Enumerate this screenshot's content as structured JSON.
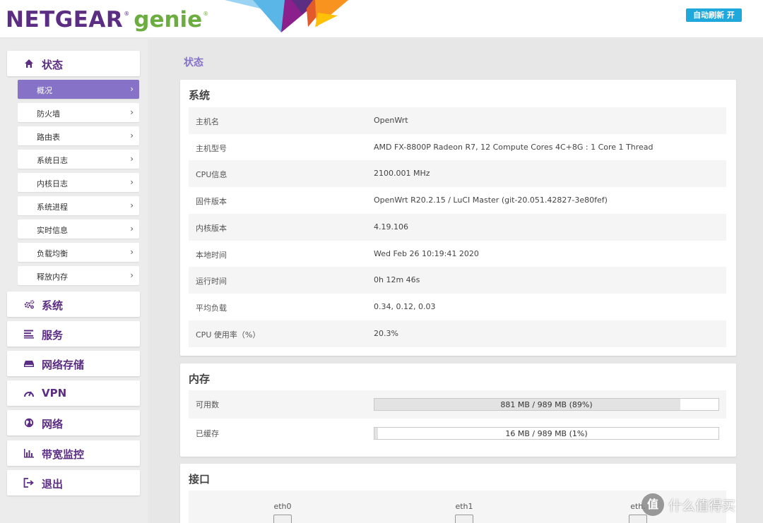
{
  "header": {
    "logo_main": "NETGEAR",
    "logo_reg": "®",
    "logo_genie": "genie",
    "logo_reg2": "®",
    "auto_refresh_label": "自动刷新 开",
    "colors": {
      "brand_purple": "#5b2d83",
      "brand_green": "#6cad3f",
      "refresh_blue": "#1ea8dc"
    }
  },
  "sidebar": {
    "status": {
      "label": "状态",
      "icon": "home-icon"
    },
    "status_items": [
      {
        "label": "概况",
        "active": true
      },
      {
        "label": "防火墙"
      },
      {
        "label": "路由表"
      },
      {
        "label": "系统日志"
      },
      {
        "label": "内核日志"
      },
      {
        "label": "系统进程"
      },
      {
        "label": "实时信息"
      },
      {
        "label": "负载均衡"
      },
      {
        "label": "释放内存"
      }
    ],
    "chevron": "›",
    "main_items": [
      {
        "label": "系统",
        "icon": "gears-icon"
      },
      {
        "label": "服务",
        "icon": "list-icon"
      },
      {
        "label": "网络存储",
        "icon": "storage-icon"
      },
      {
        "label": "VPN",
        "icon": "gauge-icon"
      },
      {
        "label": "网络",
        "icon": "globe-icon"
      },
      {
        "label": "带宽监控",
        "icon": "bar-chart-icon"
      },
      {
        "label": "退出",
        "icon": "logout-icon"
      }
    ],
    "active_color": "#8672c6"
  },
  "main": {
    "page_title": "状态",
    "system": {
      "title": "系统",
      "rows": [
        {
          "key": "主机名",
          "value": "OpenWrt"
        },
        {
          "key": "主机型号",
          "value": "AMD FX-8800P Radeon R7, 12 Compute Cores 4C+8G : 1 Core 1 Thread"
        },
        {
          "key": "CPU信息",
          "value": "2100.001 MHz"
        },
        {
          "key": "固件版本",
          "value": "OpenWrt R20.2.15 / LuCI Master (git-20.051.42827-3e80fef)"
        },
        {
          "key": "内核版本",
          "value": "4.19.106"
        },
        {
          "key": "本地时间",
          "value": "Wed Feb 26 10:19:41 2020"
        },
        {
          "key": "运行时间",
          "value": "0h 12m 46s"
        },
        {
          "key": "平均负载",
          "value": "0.34, 0.12, 0.03"
        },
        {
          "key": "CPU 使用率（%）",
          "value": "20.3%"
        }
      ]
    },
    "memory": {
      "title": "内存",
      "rows": [
        {
          "key": "可用数",
          "bar_text": "881 MB / 989 MB (89%)",
          "fraction": 0.89
        },
        {
          "key": "已缓存",
          "bar_text": "16 MB / 989 MB (1%)",
          "fraction": 0.01
        }
      ]
    },
    "interfaces": {
      "title": "接口",
      "ports": [
        {
          "label": "eth0"
        },
        {
          "label": "eth1"
        },
        {
          "label": "eth."
        }
      ]
    }
  },
  "watermark": {
    "circle": "值",
    "text": "什么值得买"
  }
}
